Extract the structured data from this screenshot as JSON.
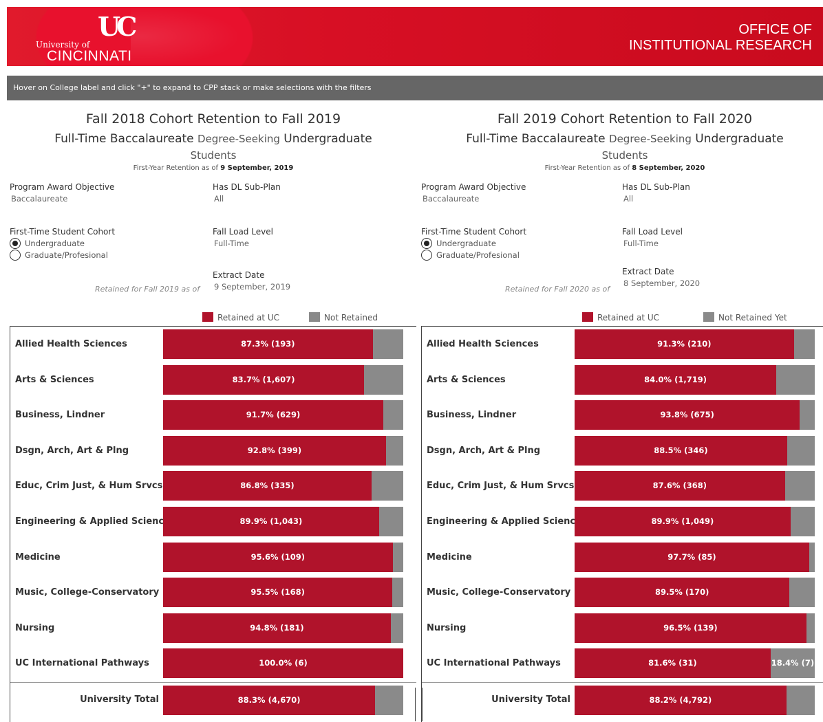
{
  "header": {
    "logo_mark": "UC",
    "logo_university": "University of",
    "logo_name": "CINCINNATI",
    "office_line1": "OFFICE OF",
    "office_line2": "INSTITUTIONAL RESEARCH"
  },
  "hint": "Hover on College label and click \"+\" to expand to CPP stack or make selections with the filters",
  "panels": [
    {
      "title": "Fall 2018 Cohort Retention to Fall 2019",
      "subtitle_a": "Full-Time Baccalaureate",
      "subtitle_b": "Degree-Seeking",
      "subtitle_c": "Undergraduate",
      "subtitle_d": "Students",
      "asof_prefix": "First-Year Retention as of",
      "asof_date": "9 September, 2019",
      "filters": {
        "program_label": "Program Award Objective",
        "program_value": "Baccalaureate",
        "dl_label": "Has DL Sub-Plan",
        "dl_value": "All",
        "cohort_label": "First-Time Student Cohort",
        "cohort_options": [
          "Undergraduate",
          "Graduate/Profesional"
        ],
        "load_label": "Fall Load Level",
        "load_value": "Full-Time",
        "extract_label": "Extract Date",
        "extract_value": "9 September, 2019",
        "retained_note": "Retained for Fall 2019 as of"
      },
      "legend": [
        "Retained at UC",
        "Not Retained"
      ],
      "chart_data": {
        "type": "bar",
        "orientation": "horizontal-stacked-100",
        "categories": [
          "Allied Health Sciences",
          "Arts & Sciences",
          "Business, Lindner",
          "Dsgn, Arch, Art & Plng",
          "Educ, Crim Just, & Hum Srvcs",
          "Engineering & Applied Science",
          "Medicine",
          "Music, College-Conservatory",
          "Nursing",
          "UC International Pathways"
        ],
        "series": [
          {
            "name": "Retained at UC",
            "values": [
              87.3,
              83.7,
              91.7,
              92.8,
              86.8,
              89.9,
              95.6,
              95.5,
              94.8,
              100.0
            ],
            "labels": [
              "87.3% (193)",
              "83.7% (1,607)",
              "91.7% (629)",
              "92.8% (399)",
              "86.8% (335)",
              "89.9% (1,043)",
              "95.6% (109)",
              "95.5% (168)",
              "94.8% (181)",
              "100.0% (6)"
            ]
          },
          {
            "name": "Not Retained",
            "values": [
              12.7,
              16.3,
              8.3,
              7.2,
              13.2,
              10.1,
              4.4,
              4.5,
              5.2,
              0.0
            ],
            "labels": [
              "",
              "",
              "",
              "",
              "",
              "",
              "",
              "",
              "",
              ""
            ]
          }
        ],
        "total": {
          "label": "University Total",
          "value": 88.3,
          "text": "88.3% (4,670)",
          "not_text": ""
        },
        "xlim": [
          0,
          100
        ],
        "colors": {
          "retained": "#b0132b",
          "not_retained": "#8a8a8a"
        }
      }
    },
    {
      "title": "Fall 2019 Cohort Retention to Fall 2020",
      "subtitle_a": "Full-Time Baccalaureate",
      "subtitle_b": "Degree-Seeking",
      "subtitle_c": "Undergraduate",
      "subtitle_d": "Students",
      "asof_prefix": "First-Year Retention as of",
      "asof_date": "8 September, 2020",
      "filters": {
        "program_label": "Program Award Objective",
        "program_value": "Baccalaureate",
        "dl_label": "Has DL Sub-Plan",
        "dl_value": "All",
        "cohort_label": "First-Time Student Cohort",
        "cohort_options": [
          "Undergraduate",
          "Graduate/Profesional"
        ],
        "load_label": "Fall Load Level",
        "load_value": "Full-Time",
        "extract_label": "Extract Date",
        "extract_value": "8 September, 2020",
        "retained_note": "Retained for Fall 2020 as of"
      },
      "legend": [
        "Retained at UC",
        "Not Retained Yet"
      ],
      "chart_data": {
        "type": "bar",
        "orientation": "horizontal-stacked-100",
        "categories": [
          "Allied Health Sciences",
          "Arts & Sciences",
          "Business, Lindner",
          "Dsgn, Arch, Art & Plng",
          "Educ, Crim Just, & Hum Srvcs",
          "Engineering & Applied Science",
          "Medicine",
          "Music, College-Conservatory",
          "Nursing",
          "UC International Pathways"
        ],
        "series": [
          {
            "name": "Retained at UC",
            "values": [
              91.3,
              84.0,
              93.8,
              88.5,
              87.6,
              89.9,
              97.7,
              89.5,
              96.5,
              81.6
            ],
            "labels": [
              "91.3% (210)",
              "84.0% (1,719)",
              "93.8% (675)",
              "88.5% (346)",
              "87.6% (368)",
              "89.9% (1,049)",
              "97.7% (85)",
              "89.5% (170)",
              "96.5% (139)",
              "81.6% (31)"
            ]
          },
          {
            "name": "Not Retained Yet",
            "values": [
              8.7,
              16.0,
              6.2,
              11.5,
              12.4,
              10.1,
              2.3,
              10.5,
              3.5,
              18.4
            ],
            "labels": [
              "",
              "",
              "",
              "",
              "",
              "",
              "",
              "",
              "",
              "18.4% (7)"
            ]
          }
        ],
        "total": {
          "label": "University Total",
          "value": 88.2,
          "text": "88.2% (4,792)",
          "not_text": ""
        },
        "xlim": [
          0,
          100
        ],
        "colors": {
          "retained": "#b0132b",
          "not_retained": "#8a8a8a"
        }
      }
    }
  ]
}
